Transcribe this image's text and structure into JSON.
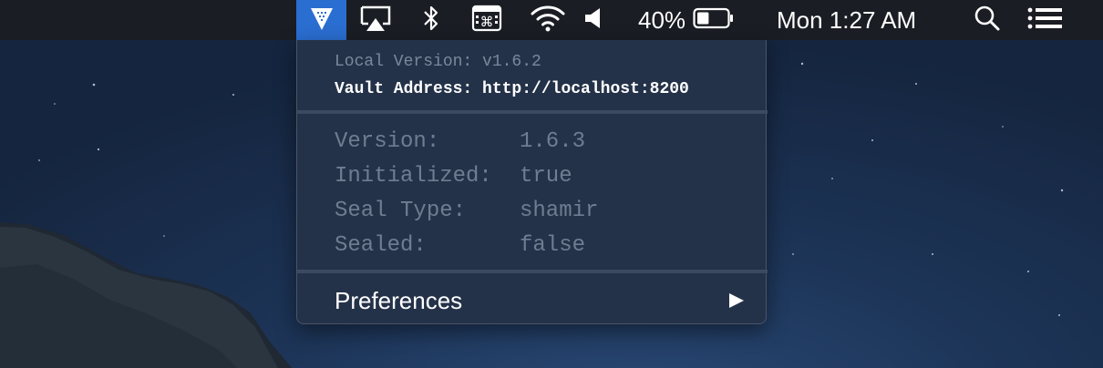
{
  "menubar": {
    "battery_percent": "40%",
    "battery_level": 0.4,
    "clock": "Mon 1:27 AM",
    "icons": [
      "vault-icon",
      "airplay-icon",
      "bluetooth-icon",
      "keyboard-viewer-icon",
      "wifi-icon",
      "volume-icon",
      "battery-icon",
      "spotlight-search-icon",
      "notification-center-icon"
    ]
  },
  "vault_menu": {
    "local_version": "Local Version: v1.6.2",
    "vault_address": "Vault Address: http://localhost:8200",
    "status_rows": [
      {
        "key": "Version:",
        "value": "1.6.3"
      },
      {
        "key": "Initialized:",
        "value": "true"
      },
      {
        "key": "Seal Type:",
        "value": "shamir"
      },
      {
        "key": "Sealed:",
        "value": "false"
      }
    ],
    "preferences_label": "Preferences"
  },
  "colors": {
    "menubar_bg": "#1a1d23",
    "vault_accent": "#2a6ed1",
    "menu_bg": "#243249",
    "menu_text_muted": "#6f7d91",
    "desktop_sky": "#1d3558"
  }
}
